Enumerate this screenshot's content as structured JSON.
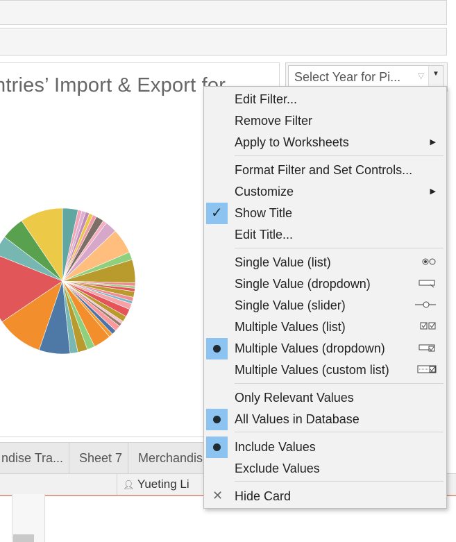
{
  "chart_title": "ntries’ Import & Export for",
  "filter": {
    "label": "Select Year for Pi..."
  },
  "menu": {
    "edit_filter": "Edit Filter...",
    "remove_filter": "Remove Filter",
    "apply_to_worksheets": "Apply to Worksheets",
    "format_filter": "Format Filter and Set Controls...",
    "customize": "Customize",
    "show_title": "Show Title",
    "edit_title": "Edit Title...",
    "single_list": "Single Value (list)",
    "single_dropdown": "Single Value (dropdown)",
    "single_slider": "Single Value (slider)",
    "multi_list": "Multiple Values (list)",
    "multi_dropdown": "Multiple Values (dropdown)",
    "multi_custom": "Multiple Values (custom list)",
    "only_relevant": "Only Relevant Values",
    "all_values": "All Values in Database",
    "include_values": "Include Values",
    "exclude_values": "Exclude Values",
    "hide_card": "Hide Card"
  },
  "sheet_tabs": [
    "ndise Tra...",
    "Sheet 7",
    "Merchandis"
  ],
  "status": {
    "user": "Yueting Li"
  },
  "colors": {
    "menu_highlight": "#8cc3f0",
    "menu_bg": "#f2f2f2"
  },
  "pie_slices": [
    {
      "value": 4.0,
      "color": "#5fa7a0"
    },
    {
      "value": 1.0,
      "color": "#f3a3b8"
    },
    {
      "value": 1.0,
      "color": "#d9b2cf"
    },
    {
      "value": 1.0,
      "color": "#c58ab5"
    },
    {
      "value": 1.0,
      "color": "#e9c94a"
    },
    {
      "value": 1.0,
      "color": "#ef9aa5"
    },
    {
      "value": 2.0,
      "color": "#7b6f66"
    },
    {
      "value": 1.0,
      "color": "#f4b0c0"
    },
    {
      "value": 3.0,
      "color": "#d6a7c9"
    },
    {
      "value": 6.5,
      "color": "#ffbe7e"
    },
    {
      "value": 2.0,
      "color": "#8fd07f"
    },
    {
      "value": 6.0,
      "color": "#b99a2d"
    },
    {
      "value": 0.8,
      "color": "#ef8c92"
    },
    {
      "value": 0.6,
      "color": "#9ccc8a"
    },
    {
      "value": 0.8,
      "color": "#e45459"
    },
    {
      "value": 1.5,
      "color": "#b99a2d"
    },
    {
      "value": 1.0,
      "color": "#f08c94"
    },
    {
      "value": 0.7,
      "color": "#7ab7c7"
    },
    {
      "value": 1.5,
      "color": "#f6a2a6"
    },
    {
      "value": 2.0,
      "color": "#e45459"
    },
    {
      "value": 1.5,
      "color": "#b99a2d"
    },
    {
      "value": 0.7,
      "color": "#f4c0cd"
    },
    {
      "value": 0.8,
      "color": "#9a7b6b"
    },
    {
      "value": 1.5,
      "color": "#fb9a9c"
    },
    {
      "value": 1.2,
      "color": "#4d73a6"
    },
    {
      "value": 1.0,
      "color": "#f59a2f"
    },
    {
      "value": 4.5,
      "color": "#f28e2b"
    },
    {
      "value": 2.0,
      "color": "#8fd07f"
    },
    {
      "value": 2.5,
      "color": "#b99a2d"
    },
    {
      "value": 2.0,
      "color": "#79b7b2"
    },
    {
      "value": 8.0,
      "color": "#4e79a7"
    },
    {
      "value": 12.0,
      "color": "#f28e2b"
    },
    {
      "value": 18.0,
      "color": "#e15759"
    },
    {
      "value": 5.0,
      "color": "#76b7b2"
    },
    {
      "value": 6.0,
      "color": "#59a14f"
    },
    {
      "value": 11.0,
      "color": "#edc948"
    }
  ]
}
